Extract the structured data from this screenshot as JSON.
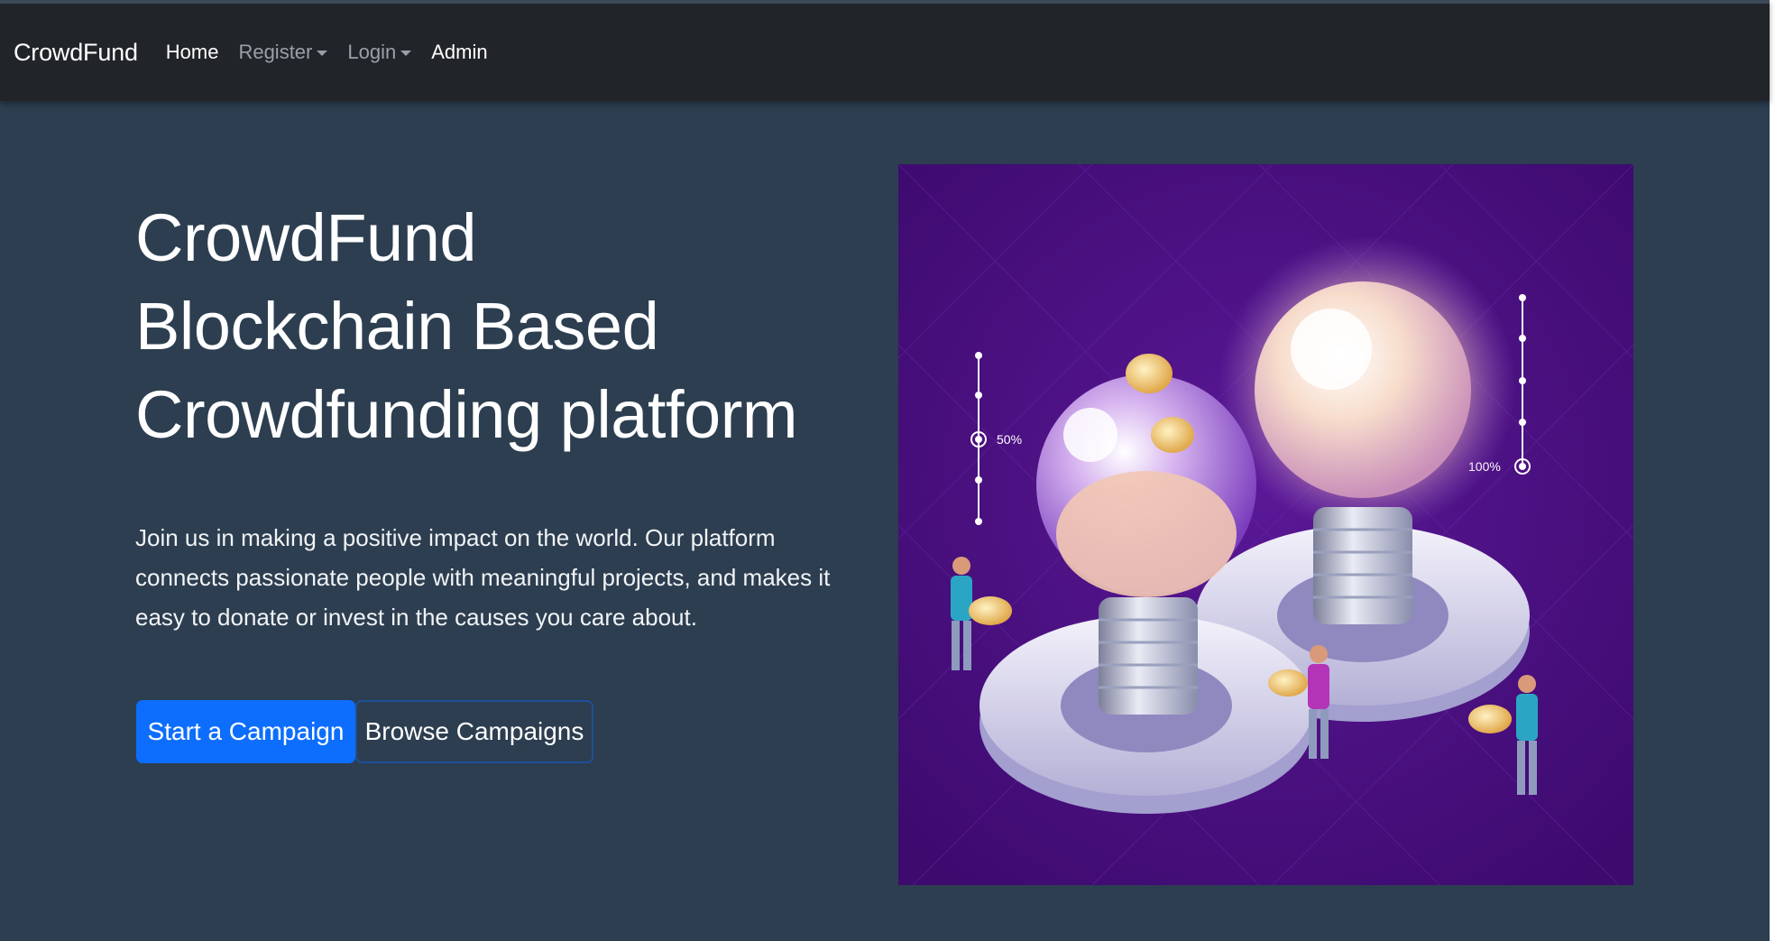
{
  "navbar": {
    "brand": "CrowdFund",
    "links": [
      {
        "label": "Home",
        "dropdown": false
      },
      {
        "label": "Register",
        "dropdown": true
      },
      {
        "label": "Login",
        "dropdown": true
      },
      {
        "label": "Admin",
        "dropdown": false
      }
    ]
  },
  "hero": {
    "title_lines": [
      "CrowdFund",
      "Blockchain Based",
      "Crowdfunding platform"
    ],
    "description": "Join us in making a positive impact on the world. Our platform connects passionate people with meaningful projects, and makes it easy to donate or invest in the causes you care about.",
    "primary_button": "Start a Campaign",
    "secondary_button": "Browse Campaigns"
  },
  "illustration": {
    "left_meter_label": "50%",
    "right_meter_label": "100%"
  },
  "colors": {
    "navbar_bg": "#212529",
    "page_bg": "#2c3e50",
    "primary": "#0d6efd",
    "illustration_bg": "#4a0d80"
  }
}
